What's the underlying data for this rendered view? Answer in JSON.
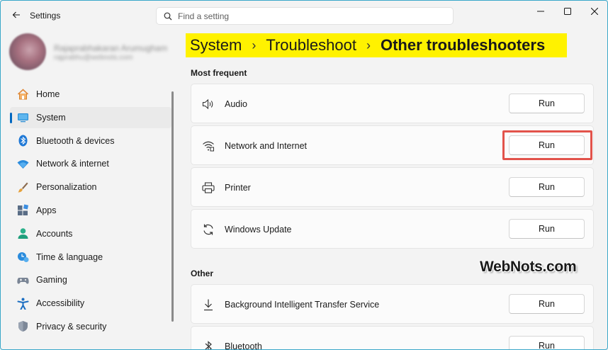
{
  "window": {
    "title": "Settings",
    "controls": {
      "minimize": "—",
      "maximize": "☐",
      "close": "✕"
    }
  },
  "search": {
    "placeholder": "Find a setting",
    "value": ""
  },
  "profile": {
    "name": "Rajaprabhakaran Arumugham",
    "email": "rajprabhu@webnots.com"
  },
  "breadcrumb": {
    "items": [
      "System",
      "Troubleshoot"
    ],
    "separator": "›",
    "current": "Other troubleshooters",
    "highlight_color": "#fff200"
  },
  "sidebar": {
    "items": [
      {
        "label": "Home",
        "icon": "home-icon"
      },
      {
        "label": "System",
        "icon": "system-icon",
        "active": true
      },
      {
        "label": "Bluetooth & devices",
        "icon": "bluetooth-icon"
      },
      {
        "label": "Network & internet",
        "icon": "wifi-icon"
      },
      {
        "label": "Personalization",
        "icon": "brush-icon"
      },
      {
        "label": "Apps",
        "icon": "apps-icon"
      },
      {
        "label": "Accounts",
        "icon": "person-icon"
      },
      {
        "label": "Time & language",
        "icon": "clock-globe-icon"
      },
      {
        "label": "Gaming",
        "icon": "gamepad-icon"
      },
      {
        "label": "Accessibility",
        "icon": "accessibility-icon"
      },
      {
        "label": "Privacy & security",
        "icon": "shield-icon"
      }
    ]
  },
  "sections": {
    "most_frequent": {
      "title": "Most frequent",
      "items": [
        {
          "label": "Audio",
          "icon": "speaker-icon",
          "button": "Run"
        },
        {
          "label": "Network and Internet",
          "icon": "network-icon",
          "button": "Run",
          "highlighted": true
        },
        {
          "label": "Printer",
          "icon": "printer-icon",
          "button": "Run"
        },
        {
          "label": "Windows Update",
          "icon": "sync-icon",
          "button": "Run"
        }
      ]
    },
    "other": {
      "title": "Other",
      "items": [
        {
          "label": "Background Intelligent Transfer Service",
          "icon": "download-icon",
          "button": "Run"
        },
        {
          "label": "Bluetooth",
          "icon": "bluetooth-icon",
          "button": "Run"
        }
      ]
    }
  },
  "watermark": "WebNots.com",
  "colors": {
    "accent": "#0067c0",
    "highlight_border": "#e2534b"
  }
}
